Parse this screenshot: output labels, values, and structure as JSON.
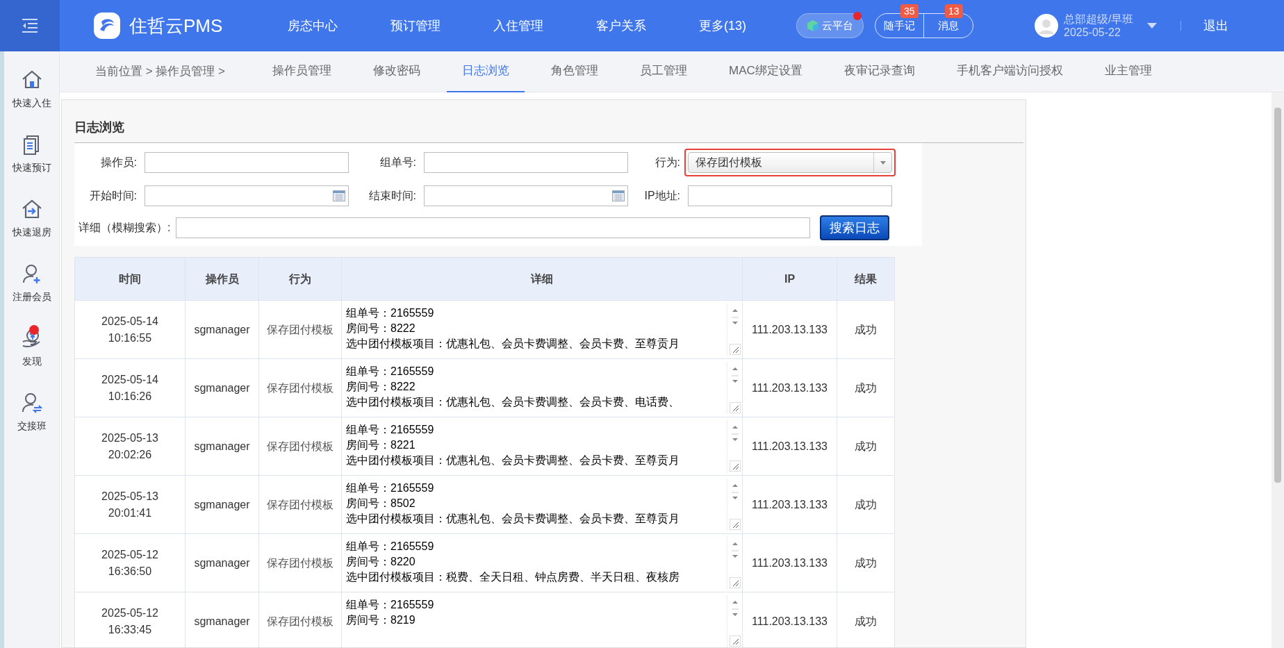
{
  "header": {
    "logo": "住哲云PMS",
    "nav": [
      "房态中心",
      "预订管理",
      "入住管理",
      "客户关系",
      "更多(13)"
    ],
    "cloud": {
      "label": "云平台",
      "alert": true
    },
    "notes": {
      "label": "随手记",
      "count": "35"
    },
    "messages": {
      "label": "消息",
      "count": "13"
    },
    "user": {
      "name": "总部超级/早班",
      "date": "2025-05-22"
    },
    "logout": "退出"
  },
  "sidebar": {
    "items": [
      {
        "kind": "home",
        "label": "快速入住",
        "badge": false
      },
      {
        "kind": "docs",
        "label": "快速预订",
        "badge": false
      },
      {
        "kind": "checkout",
        "label": "快速退房",
        "badge": false
      },
      {
        "kind": "member",
        "label": "注册会员",
        "badge": false
      },
      {
        "kind": "discover",
        "label": "发现",
        "badge": true
      },
      {
        "kind": "shift",
        "label": "交接班",
        "badge": false
      }
    ]
  },
  "subnav": {
    "breadcrumb": "当前位置 > 操作员管理 >",
    "tabs": [
      {
        "label": "操作员管理",
        "selected": false
      },
      {
        "label": "修改密码",
        "selected": false
      },
      {
        "label": "日志浏览",
        "selected": true
      },
      {
        "label": "角色管理",
        "selected": false
      },
      {
        "label": "员工管理",
        "selected": false
      },
      {
        "label": "MAC绑定设置",
        "selected": false
      },
      {
        "label": "夜审记录查询",
        "selected": false
      },
      {
        "label": "手机客户端访问授权",
        "selected": false
      },
      {
        "label": "业主管理",
        "selected": false
      }
    ]
  },
  "panel": {
    "title": "日志浏览",
    "filters": [
      {
        "kind": "text",
        "label": "操作员:",
        "highlighted": false
      },
      {
        "kind": "text",
        "label": "组单号:",
        "highlighted": false
      },
      {
        "kind": "select",
        "label": "行为:",
        "value": "保存团付模板",
        "highlighted": true
      },
      {
        "kind": "date",
        "label": "开始时间:",
        "highlighted": false
      },
      {
        "kind": "date",
        "label": "结束时间:",
        "highlighted": false
      },
      {
        "kind": "text",
        "label": "IP地址:",
        "highlighted": false
      }
    ],
    "detail_search": {
      "label": "详细（模糊搜索）:"
    },
    "search_button": "搜索日志",
    "table": {
      "columns": [
        "时间",
        "操作员",
        "行为",
        "详细",
        "IP",
        "结果"
      ],
      "rows": [
        {
          "date": "2025-05-14",
          "time": "10:16:55",
          "operator": "sgmanager",
          "action": "保存团付模板",
          "detail": [
            "组单号：2165559",
            "房间号：8222",
            "选中团付模板项目：优惠礼包、会员卡费调整、会员卡费、至尊贡月"
          ],
          "ip": "111.203.13.133",
          "result": "成功"
        },
        {
          "date": "2025-05-14",
          "time": "10:16:26",
          "operator": "sgmanager",
          "action": "保存团付模板",
          "detail": [
            "组单号：2165559",
            "房间号：8222",
            "选中团付模板项目：优惠礼包、会员卡费调整、会员卡费、电话费、"
          ],
          "ip": "111.203.13.133",
          "result": "成功"
        },
        {
          "date": "2025-05-13",
          "time": "20:02:26",
          "operator": "sgmanager",
          "action": "保存团付模板",
          "detail": [
            "组单号：2165559",
            "房间号：8221",
            "选中团付模板项目：优惠礼包、会员卡费调整、会员卡费、至尊贡月"
          ],
          "ip": "111.203.13.133",
          "result": "成功"
        },
        {
          "date": "2025-05-13",
          "time": "20:01:41",
          "operator": "sgmanager",
          "action": "保存团付模板",
          "detail": [
            "组单号：2165559",
            "房间号：8502",
            "选中团付模板项目：优惠礼包、会员卡费调整、会员卡费、至尊贡月"
          ],
          "ip": "111.203.13.133",
          "result": "成功"
        },
        {
          "date": "2025-05-12",
          "time": "16:36:50",
          "operator": "sgmanager",
          "action": "保存团付模板",
          "detail": [
            "组单号：2165559",
            "房间号：8220",
            "选中团付模板项目：税费、全天日租、钟点房费、半天日租、夜核房"
          ],
          "ip": "111.203.13.133",
          "result": "成功"
        },
        {
          "date": "2025-05-12",
          "time": "16:33:45",
          "operator": "sgmanager",
          "action": "保存团付模板",
          "detail": [
            "组单号：2165559",
            "房间号：8219"
          ],
          "ip": "111.203.13.133",
          "result": "成功"
        }
      ]
    }
  }
}
